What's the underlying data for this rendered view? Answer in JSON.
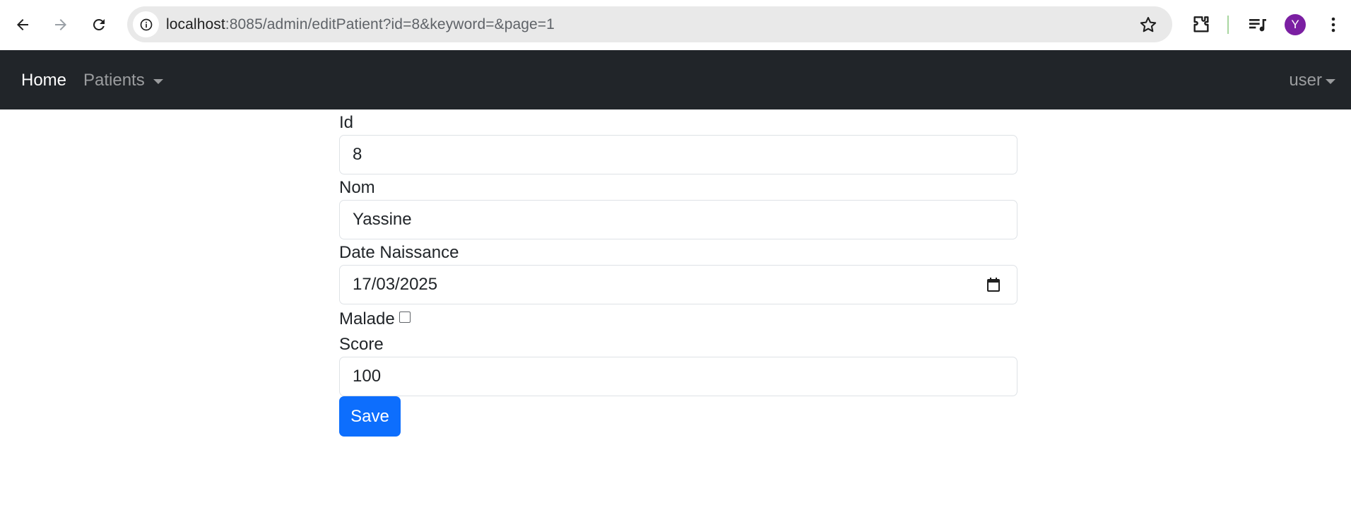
{
  "browser": {
    "url_host": "localhost",
    "url_rest": ":8085/admin/editPatient?id=8&keyword=&page=1",
    "profile_initial": "Y",
    "icons": [
      "back-arrow-icon",
      "forward-arrow-icon",
      "reload-icon",
      "site-info-icon",
      "bookmark-star-icon",
      "extensions-icon",
      "media-controls-icon",
      "kebab-menu-icon"
    ]
  },
  "navbar": {
    "home_label": "Home",
    "patients_label": "Patients",
    "user_label": "user"
  },
  "form": {
    "id_label": "Id",
    "id_value": "8",
    "nom_label": "Nom",
    "nom_value": "Yassine",
    "date_label": "Date Naissance",
    "date_value": "17/03/2025",
    "malade_label": "Malade",
    "malade_checked": false,
    "score_label": "Score",
    "score_value": "100",
    "save_label": "Save"
  },
  "colors": {
    "navbar_bg": "#212529",
    "primary_button": "#0d6efd",
    "avatar_bg": "#7b1fa2"
  }
}
